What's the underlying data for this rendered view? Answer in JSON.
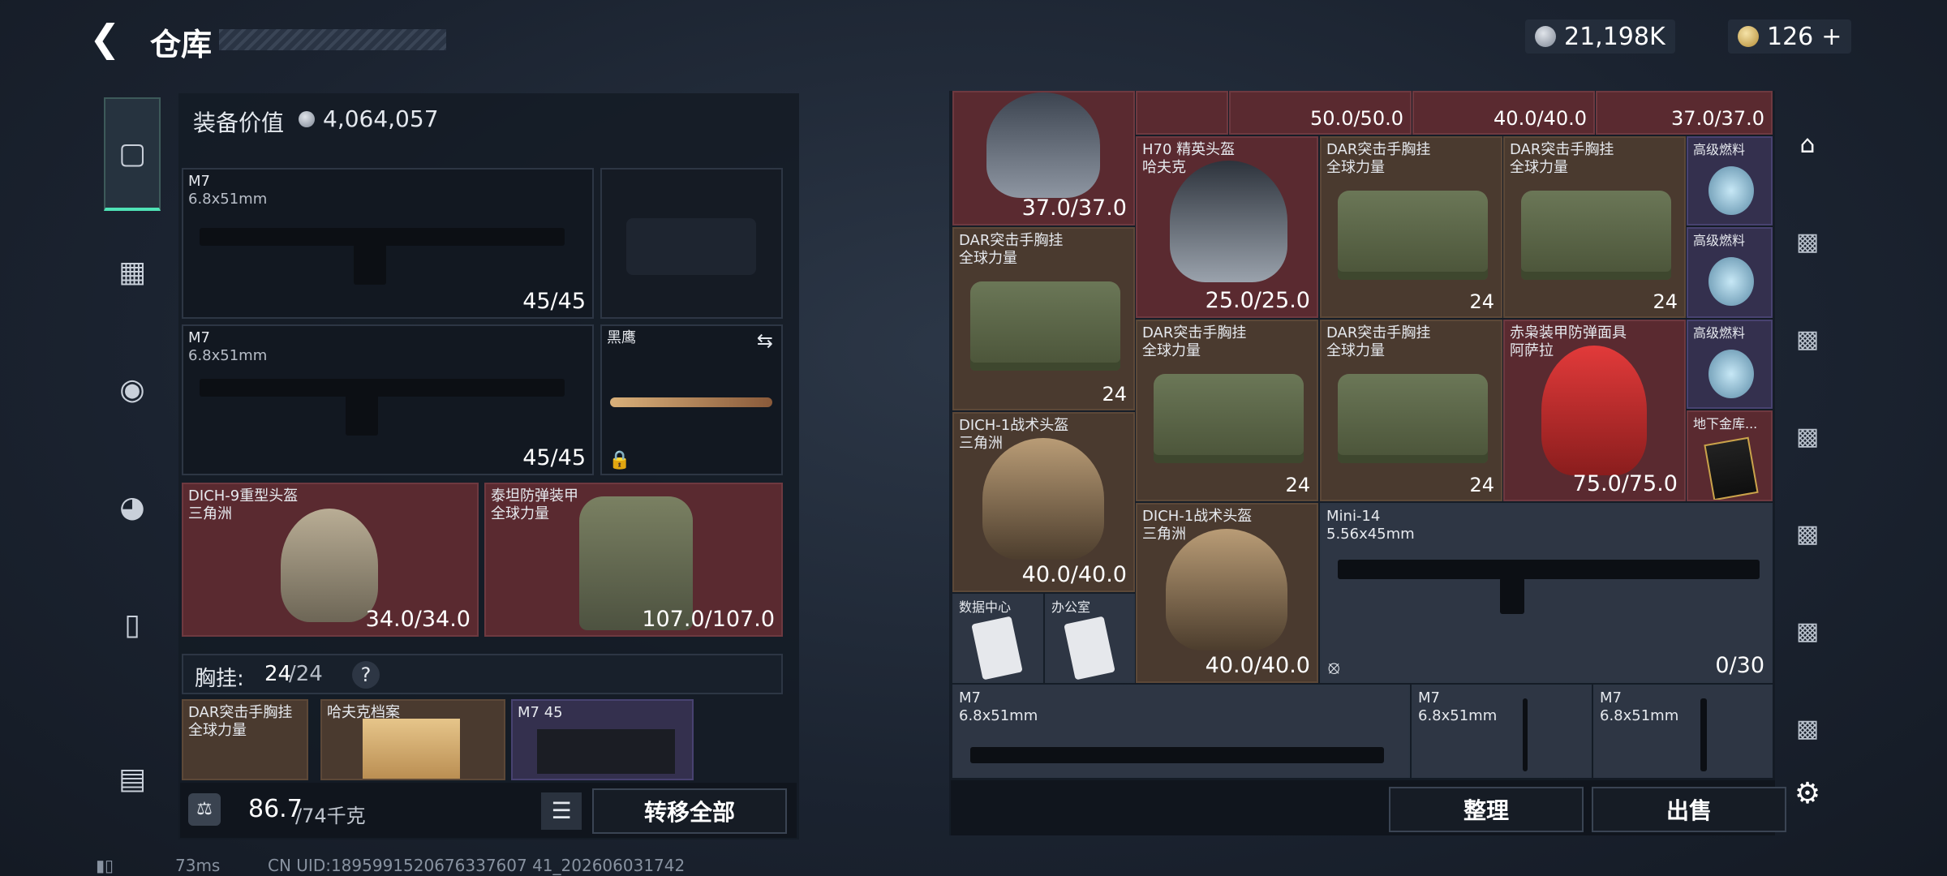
{
  "title": "仓库",
  "currency": {
    "silver": "21,198K",
    "gold": "126",
    "gold_plus": "+"
  },
  "left": {
    "equip_value_label": "装备价值",
    "equip_value": "4,064,057",
    "weapon1": {
      "name": "M7",
      "caliber": "6.8x51mm",
      "ammo": "45/45"
    },
    "weapon2": {
      "name": "M7",
      "caliber": "6.8x51mm",
      "ammo": "45/45"
    },
    "knife": {
      "name": "黑鹰"
    },
    "helmet": {
      "name": "DICH-9重型头盔",
      "faction": "三角洲",
      "durability": "34.0/34.0"
    },
    "armor": {
      "name": "泰坦防弹装甲",
      "faction": "全球力量",
      "durability": "107.0/107.0"
    },
    "rig": {
      "label": "胸挂:",
      "used": "24",
      "max": "/24",
      "help": "?"
    },
    "rig_items": [
      {
        "name": "DAR突击手胸挂",
        "sub": "全球力量"
      },
      {
        "name": "哈夫克档案",
        "sub": ""
      },
      {
        "name": "M7 45",
        "sub": ""
      }
    ],
    "weight": "86.7",
    "weight_max": "/74千克",
    "transfer_all": "转移全部"
  },
  "stash": {
    "top_vals": [
      "50.0/50.0",
      "40.0/40.0",
      "37.0/37.0"
    ],
    "helmet_top": {
      "durability": "37.0/37.0"
    },
    "h70": {
      "name": "H70 精英头盔",
      "sub": "哈夫克",
      "durability": "25.0/25.0"
    },
    "dar_label": "DAR突击手胸挂",
    "dar_sub": "全球力量",
    "dar_count": "24",
    "fuel_label": "高级燃料",
    "red_mask": {
      "name": "赤枭装甲防弹面具",
      "sub": "阿萨拉",
      "durability": "75.0/75.0"
    },
    "card": {
      "name": "地下金库..."
    },
    "dich1": {
      "name": "DICH-1战术头盔",
      "sub": "三角洲",
      "durability": "40.0/40.0"
    },
    "mini14": {
      "name": "Mini-14",
      "caliber": "5.56x45mm",
      "ammo": "0/30"
    },
    "keys": [
      "数据中心",
      "办公室"
    ],
    "m7": {
      "name": "M7",
      "caliber": "6.8x51mm"
    },
    "sort": "整理",
    "sell": "出售"
  },
  "status": {
    "ping": "73ms",
    "uid": "CN UID:1895991520676337607 41_202606031742"
  }
}
